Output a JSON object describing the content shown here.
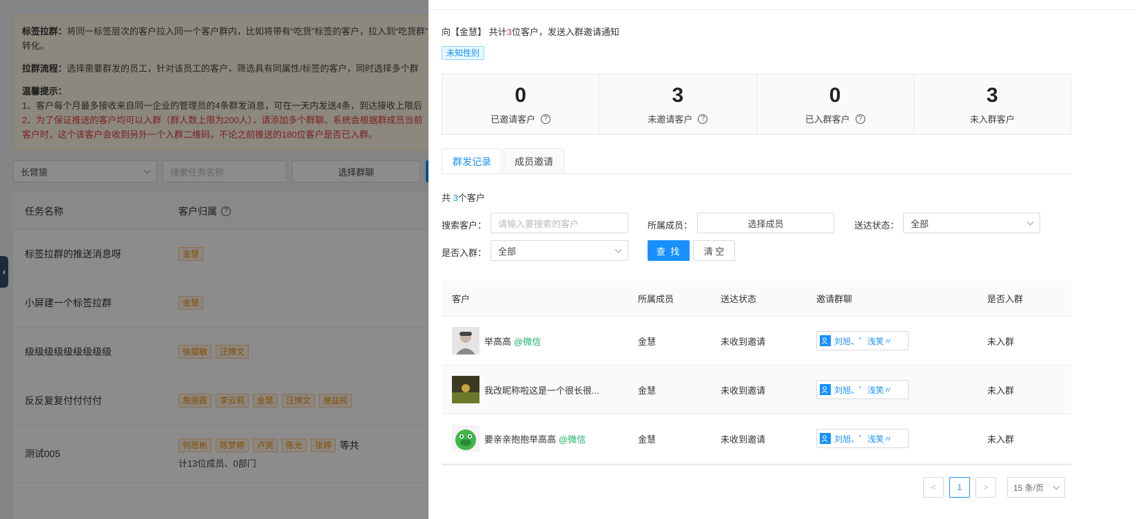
{
  "background": {
    "notice": {
      "tag_title": "标签拉群：",
      "tag_text": "将同一标签层次的客户拉入同一个客户群内，比如将带有“吃货”标签的客户，拉入到“吃货群”",
      "tag_text2": "转化。",
      "flow_title": "拉群流程：",
      "flow_text": "选择需要群发的员工，针对该员工的客户，筛选具有同属性/标签的客户，同时选择多个群",
      "tips_title": "温馨提示：",
      "tip1": "1、客户每个月最多接收来自同一企业的管理员的4条群发消息，可在一天内发送4条，到达接收上限后",
      "tip2": "2、为了保证推送的客户均可以入群（群人数上限为200人），请添加多个群聊。系统会根据群成员当前",
      "tip3": "客户时，这个该客户会收到另外一个入群二维码，不论之前推送的180位客户是否已入群。"
    },
    "filters": {
      "employee_select": "长臂猿",
      "task_search_placeholder": "搜索任务名称",
      "select_group_button": "选择群聊",
      "search_button": "查 找"
    },
    "table": {
      "headers": [
        "任务名称",
        "客户归属"
      ],
      "rows": [
        {
          "name": "标签拉群的推送消息呀",
          "tags": [
            "金慧"
          ],
          "extra": ""
        },
        {
          "name": "小屏建一个标签拉群",
          "tags": [
            "金慧"
          ],
          "extra": ""
        },
        {
          "name": "级级级级级级级级级",
          "tags": [
            "徐熠敏",
            "汪博文"
          ],
          "extra": ""
        },
        {
          "name": "反反复复付付付付",
          "tags": [
            "詹丽霞",
            "李云莉",
            "金慧",
            "汪博文",
            "施益民"
          ],
          "extra": ""
        },
        {
          "name": "测试005",
          "tags": [
            "何思彬",
            "陈梦婷",
            "卢亮",
            "陈允",
            "张婷"
          ],
          "extra": "等共",
          "extra2": "计13位成员、0部门"
        }
      ]
    }
  },
  "drawer": {
    "title_prefix": "向【金慧】 共计",
    "title_count": "3",
    "title_suffix": "位客户，发送入群邀请通知",
    "gender_tag": "未知性别",
    "stats": [
      {
        "value": "0",
        "label": "已邀请客户",
        "help": true
      },
      {
        "value": "3",
        "label": "未邀请客户",
        "help": true
      },
      {
        "value": "0",
        "label": "已入群客户",
        "help": true
      },
      {
        "value": "3",
        "label": "未入群客户",
        "help": false
      }
    ],
    "tabs": [
      {
        "label": "群发记录",
        "active": true
      },
      {
        "label": "成员邀请",
        "active": false
      }
    ],
    "count_prefix": "共 ",
    "count_value": "3",
    "count_suffix": "个客户",
    "form": {
      "search_label": "搜索客户：",
      "search_placeholder": "请输入要搜索的客户",
      "member_label": "所属成员：",
      "member_button": "选择成员",
      "status_label": "送达状态：",
      "status_value": "全部",
      "joined_label": "是否入群：",
      "joined_value": "全部",
      "search_button": "查 找",
      "clear_button": "清 空"
    },
    "table": {
      "headers": [
        "客户",
        "所属成员",
        "送达状态",
        "邀请群聊",
        "是否入群"
      ],
      "rows": [
        {
          "name": "举高高",
          "channel": "@微信",
          "member": "金慧",
          "status": "未收到邀请",
          "group": "刘旭、゜浅笑〃",
          "joined": "未入群",
          "avatar_color": "#c9c9c9"
        },
        {
          "name": "我改昵称啦这是一个很长很...",
          "channel": "",
          "member": "金慧",
          "status": "未收到邀请",
          "group": "刘旭、゜浅笑〃",
          "joined": "未入群",
          "avatar_color": "#5a6b2f"
        },
        {
          "name": "要亲亲抱抱举高高",
          "channel": "@微信",
          "member": "金慧",
          "status": "未收到邀请",
          "group": "刘旭、゜浅笑〃",
          "joined": "未入群",
          "avatar_color": "#36b24a"
        }
      ]
    },
    "pagination": {
      "prev": "<",
      "page": "1",
      "next": ">",
      "page_size": "15 条/页"
    }
  }
}
